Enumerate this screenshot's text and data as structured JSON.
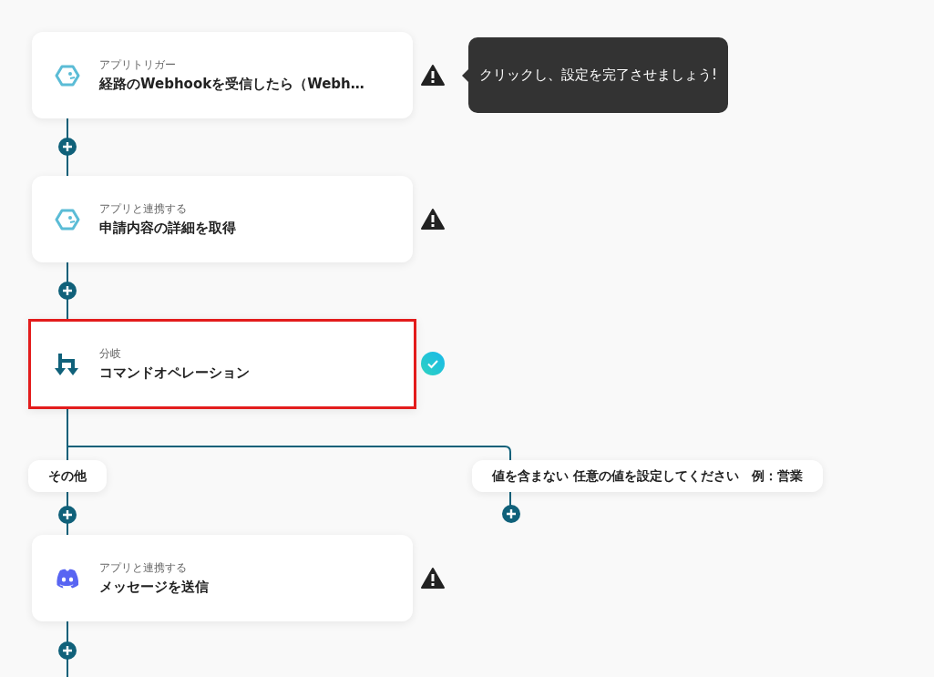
{
  "steps": [
    {
      "kind": "app",
      "category": "アプリトリガー",
      "title": "経路のWebhookを受信したら（Webh…",
      "completed": false,
      "highlighted": false
    },
    {
      "kind": "app",
      "category": "アプリと連携する",
      "title": "申請内容の詳細を取得",
      "completed": false,
      "highlighted": false
    },
    {
      "kind": "branch",
      "category": "分岐",
      "title": "コマンドオペレーション",
      "completed": true,
      "highlighted": true
    },
    {
      "kind": "app",
      "category": "アプリと連携する",
      "title": "メッセージを送信",
      "completed": false,
      "highlighted": false
    }
  ],
  "tooltip": {
    "text": "クリックし、設定を完了させましょう!"
  },
  "branches": [
    {
      "label": "その他"
    },
    {
      "label": "値を含まない 任意の値を設定してください　例：営業"
    }
  ]
}
